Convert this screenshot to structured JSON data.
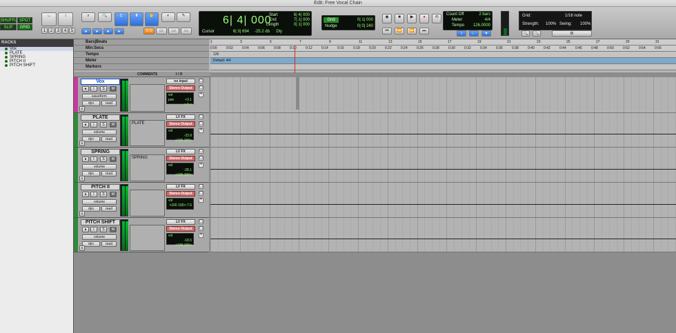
{
  "window": {
    "title": "Edit: Free Vocal Chain"
  },
  "modes": {
    "shuffle": "SHUFFLE",
    "spot": "SPOT",
    "slip": "SLIP",
    "grid": "GRID"
  },
  "zoom_presets": [
    "1",
    "2",
    "3",
    "4",
    "5"
  ],
  "counter": {
    "main": "6| 4| 000",
    "cursor_label": "Cursor",
    "cursor_value": "6| 3| 694",
    "db": "-25.2 db",
    "dly": "Dly",
    "start_label": "Start",
    "start": "6| 4| 000",
    "end_label": "End",
    "end": "7| 1| 000",
    "length_label": "Length",
    "length": "0| 1| 000"
  },
  "grid_nudge": {
    "grid_label": "Grid",
    "grid_value": "0| 1| 000",
    "nudge_label": "Nudge",
    "nudge_value": "0| 0| 240"
  },
  "tempo": {
    "count_off": "Count Off",
    "bars": "2 bars",
    "meter_label": "Meter",
    "meter": "4/4",
    "tempo_label": "Tempo",
    "tempo": "126.0000"
  },
  "grid_panel": {
    "grid_label": "Grid:",
    "grid_value": "1/16 note",
    "strength_label": "Strength:",
    "strength": "100%",
    "swing_label": "Swing:",
    "swing": "100%"
  },
  "tracklist": {
    "header": "RACKS",
    "items": [
      "Vox",
      "PLATE",
      "SPRING",
      "PITCH II",
      "PITCH SHIFT"
    ]
  },
  "rulers": {
    "bars": "Bars|Beats",
    "minsec": "Min:Secs",
    "tempo": "Tempo",
    "meter": "Meter",
    "markers": "Markers",
    "tempo_value": "126",
    "meter_value": "Default: 4/4",
    "bar_ticks": [
      "1",
      "3",
      "5",
      "7",
      "9",
      "11",
      "13",
      "15",
      "17",
      "19",
      "21",
      "23",
      "25",
      "27",
      "29",
      "31"
    ],
    "time_ticks": [
      "0:00",
      "0:02",
      "0:04",
      "0:06",
      "0:08",
      "0:10",
      "0:12",
      "0:14",
      "0:16",
      "0:18",
      "0:20",
      "0:22",
      "0:24",
      "0:26",
      "0:28",
      "0:30",
      "0:32",
      "0:34",
      "0:36",
      "0:38",
      "0:40",
      "0:42",
      "0:44",
      "0:46",
      "0:48",
      "0:50",
      "0:52",
      "0:54",
      "0:56"
    ]
  },
  "columns": {
    "comments": "COMMENTS",
    "io": "I / O"
  },
  "tracks": [
    {
      "name": "Vox",
      "view": "waveform",
      "dyn": "dyn",
      "read": "read",
      "comment": "",
      "input": "no input",
      "output": "Stereo Output",
      "vol": "+3.1",
      "pan": "> 0 <",
      "color": "#c83aa0"
    },
    {
      "name": "PLATE",
      "view": "volume",
      "dyn": "dyn",
      "read": "read",
      "comment": "PLATE",
      "input": "LV FX",
      "output": "Stereo Output",
      "vol": "-23.9",
      "pan": "<100  100>",
      "color": "#2f8a3a"
    },
    {
      "name": "SPRING",
      "view": "volume",
      "dyn": "dyn",
      "read": "read",
      "comment": "SPRING",
      "input": "LV FX",
      "output": "Stereo Output",
      "vol": "-28.1",
      "pan": "<100  100>",
      "color": "#2f8a3a"
    },
    {
      "name": "PITCH II",
      "view": "volume",
      "dyn": "dyn",
      "read": "read",
      "comment": "",
      "input": "LV FX",
      "output": "Stereo Output",
      "vol": "-7.5",
      "pan": "<100  100>",
      "color": "#2f8a3a"
    },
    {
      "name": "PITCH SHIFT",
      "view": "volume",
      "dyn": "dyn",
      "read": "read",
      "comment": "",
      "input": "LV FX",
      "output": "Stereo Output",
      "vol": "-18.5",
      "pan": "<100  100>",
      "color": "#2f8a3a"
    }
  ],
  "labels": {
    "vol": "vol",
    "pan": "pan"
  }
}
